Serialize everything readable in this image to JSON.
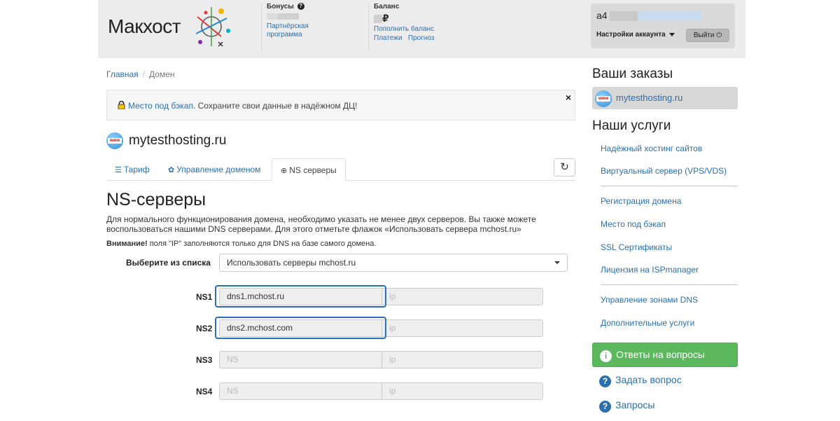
{
  "header": {
    "logo_text": "Макхост",
    "bonuses": {
      "title": "Бонусы",
      "link": "Партнёрская программа",
      "link_line1": "Партнёрская",
      "link_line2": "программа"
    },
    "balance": {
      "title": "Баланс",
      "currency": "₽",
      "topup_link": "Пополнить баланс",
      "payments_link": "Платежи",
      "forecast_link": "Прогноз"
    },
    "account": {
      "user_prefix": "a4",
      "settings_label": "Настройки аккаунта",
      "logout_label": "Выйти"
    }
  },
  "breadcrumb": {
    "home": "Главная",
    "sep": "/",
    "current": "Домен"
  },
  "alert": {
    "link": "Место под бэкап",
    "text": ". Сохраните свои данные в надёжном ДЦ!",
    "close": "×"
  },
  "domain": {
    "name": "mytesthosting.ru"
  },
  "tabs": [
    {
      "label": "Тариф",
      "icon": "sliders-icon"
    },
    {
      "label": "Управление доменом",
      "icon": "gear-icon"
    },
    {
      "label": "NS серверы",
      "icon": "globe-icon"
    }
  ],
  "ns_section": {
    "title": "NS-серверы",
    "description": "Для нормального функционирования домена, необходимо указать не менее двух серверов. Вы также можете воспользоваться нашими DNS серверами. Для этого отметьте флажок «Использовать сервера mchost.ru»",
    "warning_bold": "Внимание!",
    "warning_text": " поля \"IP\" заполняются только для DNS на базе самого домена.",
    "select_label": "Выберите из списка",
    "select_value": "Использовать серверы mchost.ru",
    "rows": [
      {
        "label": "NS1",
        "ns_value": "dns1.mchost.ru",
        "ip_placeholder": "ip"
      },
      {
        "label": "NS2",
        "ns_value": "dns2.mchost.com",
        "ip_placeholder": "ip"
      },
      {
        "label": "NS3",
        "ns_placeholder": "NS",
        "ip_placeholder": "ip"
      },
      {
        "label": "NS4",
        "ns_placeholder": "NS",
        "ip_placeholder": "ip"
      }
    ]
  },
  "sidebar": {
    "orders_title": "Ваши заказы",
    "order_item": "mytesthosting.ru",
    "services_title": "Наши услуги",
    "services": [
      "Надёжный хостинг сайтов",
      "Виртуальный сервер (VPS/VDS)",
      "Регистрация домена",
      "Место под бэкап",
      "SSL Сертификаты",
      "Лицензия на ISPmanager",
      "Управление зонами DNS",
      "Дополнительные услуги"
    ],
    "faq_button": "Ответы на вопросы",
    "ask_link": "Задать вопрос",
    "requests_link": "Запросы"
  },
  "colors": {
    "link": "#2a6fb0",
    "success": "#5cb85c",
    "highlight": "#2c6fb7",
    "header_bg": "#ececec"
  }
}
